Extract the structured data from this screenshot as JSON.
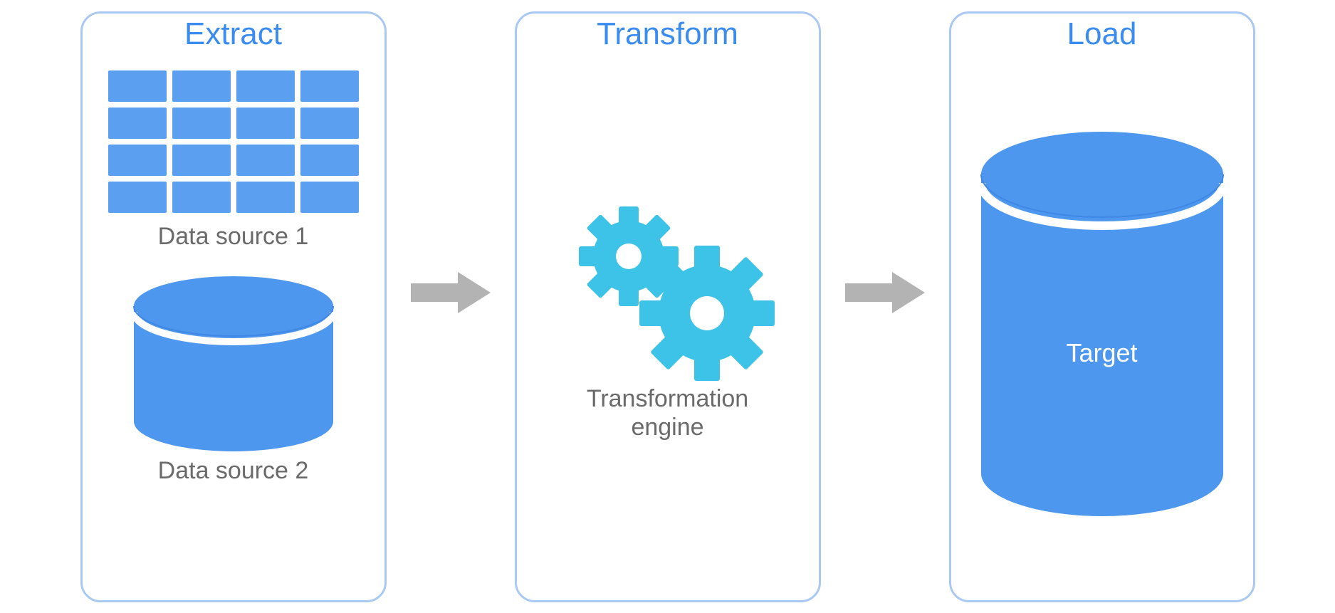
{
  "colors": {
    "panel_border": "#aac9f2",
    "title_blue": "#3a8cf0",
    "block_blue": "#5b9ff0",
    "cyl_blue": "#4e97ee",
    "cyl_blue_dark": "#3f87e4",
    "gear_cyan": "#3ec3e8",
    "arrow_gray": "#b3b3b3",
    "caption_gray": "#6a6a6a",
    "white": "#ffffff"
  },
  "extract": {
    "title": "Extract",
    "source1_label": "Data source 1",
    "source2_label": "Data source 2",
    "grid_rows": 4,
    "grid_cols": 4
  },
  "transform": {
    "title": "Transform",
    "engine_label_line1": "Transformation",
    "engine_label_line2": "engine"
  },
  "load": {
    "title": "Load",
    "target_label": "Target"
  }
}
